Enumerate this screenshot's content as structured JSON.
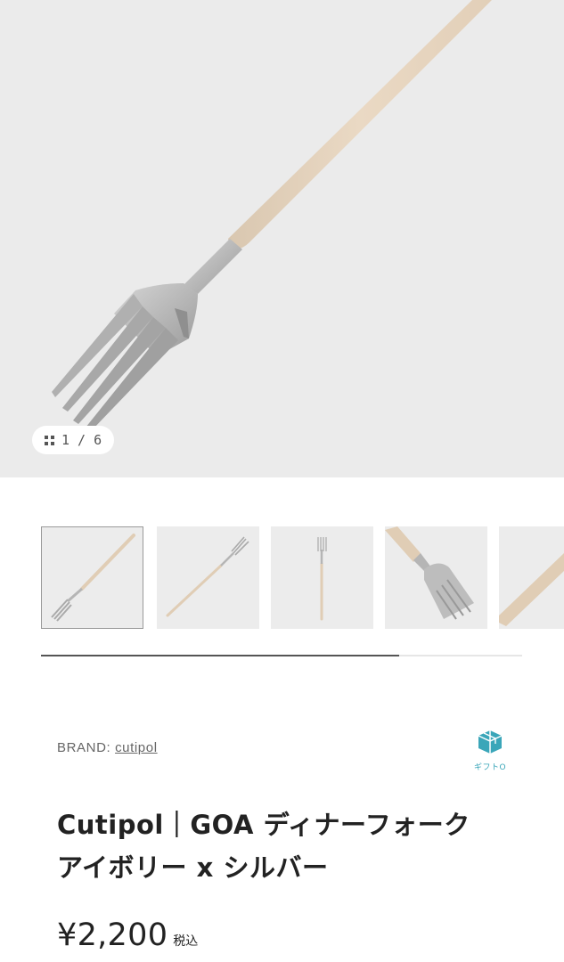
{
  "gallery": {
    "counter": "1 / 6",
    "thumbnails": [
      {
        "name": "thumbnail-1",
        "selected": true
      },
      {
        "name": "thumbnail-2",
        "selected": false
      },
      {
        "name": "thumbnail-3",
        "selected": false
      },
      {
        "name": "thumbnail-4",
        "selected": false
      },
      {
        "name": "thumbnail-5",
        "selected": false
      }
    ],
    "progress_fraction": 0.745
  },
  "product": {
    "brand_prefix": "BRAND:",
    "brand_name": "cutipol",
    "gift_label": "ギフトO",
    "title_line1": "Cutipol｜GOA ディナーフォーク",
    "title_line2": "アイボリー x シルバー",
    "price": "¥2,200",
    "tax_label": "税込"
  },
  "colors": {
    "background": "#ffffff",
    "image_bg": "#ebebeb",
    "handle": "#e6d6c2",
    "steel": "#bdbdbd",
    "gift_accent": "#3aa6b9"
  },
  "icons": {
    "counter": "grid-icon",
    "gift": "gift-box-icon"
  }
}
